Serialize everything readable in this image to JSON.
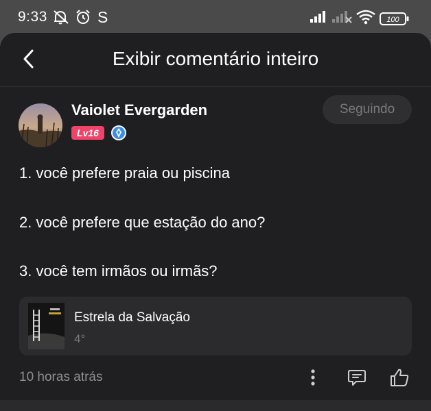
{
  "status_bar": {
    "time": "9:33",
    "carrier_letter": "S",
    "battery": "100"
  },
  "header": {
    "title": "Exibir comentário inteiro"
  },
  "author": {
    "name": "Vaiolet Evergarden",
    "level": "Lv16",
    "follow_label": "Seguindo"
  },
  "comment": {
    "lines": [
      "1. você prefere praia ou piscina",
      "2. você prefere que estação do ano?",
      "3. você tem irmãos ou irmãs?"
    ]
  },
  "attachment": {
    "title": "Estrela da Salvação",
    "subtitle": "4°"
  },
  "footer": {
    "timestamp": "10 horas atrás"
  },
  "colors": {
    "background": "#1f1f21",
    "level_badge": "#f0436a",
    "verified": "#3a8ee6"
  }
}
